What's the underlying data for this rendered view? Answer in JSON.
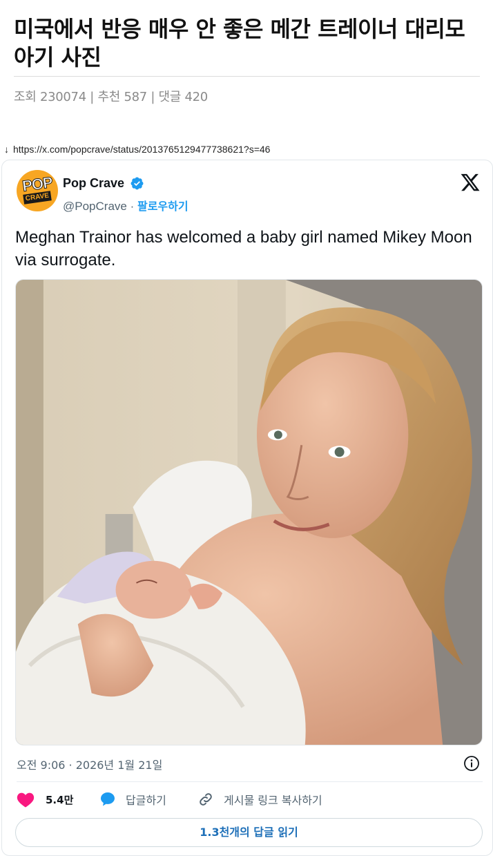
{
  "post": {
    "title": "미국에서 반응 매우 안 좋은 메간 트레이너 대리모 아기 사진",
    "stats": {
      "views_label": "조회",
      "views": "230074",
      "recommend_label": "추천",
      "recommends": "587",
      "comments_label": "댓글",
      "comments": "420",
      "separator": "|"
    },
    "source_arrow": "↓",
    "source_url": "https://x.com/popcrave/status/2013765129477738621?s=46"
  },
  "tweet": {
    "avatar_text_top": "POP",
    "avatar_text_bottom": "CRAVE",
    "author_name": "Pop Crave",
    "handle": "@PopCrave",
    "handle_separator": " · ",
    "follow_label": "팔로우하기",
    "text": "Meghan Trainor has welcomed a baby girl named Mikey Moon via surrogate.",
    "timestamp": "오전 9:06 · 2026년 1월 21일",
    "likes": "5.4만",
    "reply_label": "답글하기",
    "copy_link_label": "게시물 링크 복사하기",
    "read_replies_label": "1.3천개의 답글 읽기"
  },
  "colors": {
    "brand_blue": "#1d9bf0",
    "like_pink": "#f91880",
    "avatar_orange": "#f7a623",
    "muted_text": "#536471"
  },
  "icons": [
    "verified-badge-icon",
    "x-logo-icon",
    "info-icon",
    "heart-icon",
    "reply-bubble-icon",
    "link-icon"
  ]
}
